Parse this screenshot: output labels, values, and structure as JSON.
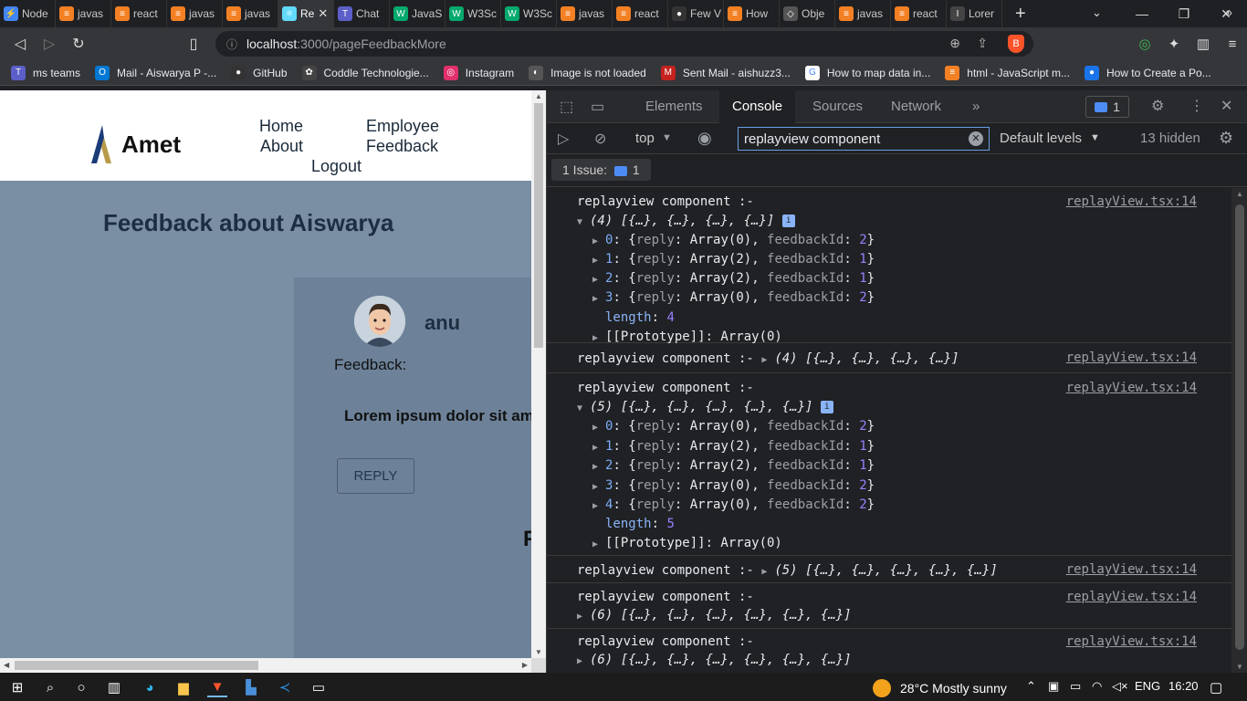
{
  "browser": {
    "tabs": [
      {
        "label": "Node",
        "color": "#4285f4",
        "glyph": "⚡"
      },
      {
        "label": "javas",
        "color": "#f48024",
        "glyph": "≡"
      },
      {
        "label": "react",
        "color": "#f48024",
        "glyph": "≡"
      },
      {
        "label": "javas",
        "color": "#f48024",
        "glyph": "≡"
      },
      {
        "label": "javas",
        "color": "#f48024",
        "glyph": "≡"
      },
      {
        "label": "Re",
        "color": "#61dafb",
        "glyph": "⚛",
        "active": true
      },
      {
        "label": "Chat",
        "color": "#5b5fc7",
        "glyph": "T"
      },
      {
        "label": "JavaS",
        "color": "#04aa6d",
        "glyph": "W"
      },
      {
        "label": "W3Sc",
        "color": "#04aa6d",
        "glyph": "W"
      },
      {
        "label": "W3Sc",
        "color": "#04aa6d",
        "glyph": "W"
      },
      {
        "label": "javas",
        "color": "#f48024",
        "glyph": "≡"
      },
      {
        "label": "react",
        "color": "#f48024",
        "glyph": "≡"
      },
      {
        "label": "Few V",
        "color": "#333333",
        "glyph": "●"
      },
      {
        "label": "How",
        "color": "#f48024",
        "glyph": "≡"
      },
      {
        "label": "Obje",
        "color": "#555555",
        "glyph": "◇"
      },
      {
        "label": "javas",
        "color": "#f48024",
        "glyph": "≡"
      },
      {
        "label": "react",
        "color": "#f48024",
        "glyph": "≡"
      },
      {
        "label": "Lorer",
        "color": "#444444",
        "glyph": "I"
      }
    ],
    "url_host": "localhost",
    "url_path": ":3000/pageFeedbackMore",
    "bookmarks": [
      {
        "label": "ms teams",
        "color": "#5b5fc7",
        "glyph": "T"
      },
      {
        "label": "Mail - Aiswarya P -...",
        "color": "#0078d4",
        "glyph": "O"
      },
      {
        "label": "GitHub",
        "color": "#333333",
        "glyph": "●"
      },
      {
        "label": "Coddle Technologie...",
        "color": "#444444",
        "glyph": "✿"
      },
      {
        "label": "Instagram",
        "color": "#e1306c",
        "glyph": "◎"
      },
      {
        "label": "Image is not loaded",
        "color": "#555555",
        "glyph": "◐"
      },
      {
        "label": "Sent Mail - aishuzz3...",
        "color": "#c5221f",
        "glyph": "M"
      },
      {
        "label": "How to map data in...",
        "color": "#ffffff",
        "glyph": "G"
      },
      {
        "label": "html - JavaScript m...",
        "color": "#f48024",
        "glyph": "≡"
      },
      {
        "label": "How to Create a Po...",
        "color": "#1a73e8",
        "glyph": "●"
      }
    ]
  },
  "app": {
    "logo": "Amet",
    "nav": {
      "home": "Home",
      "employee": "Employee",
      "about": "About",
      "feedback": "Feedback",
      "logout": "Logout"
    },
    "title": "Feedback about Aiswarya",
    "card": {
      "username": "anu",
      "feedback_label": "Feedback:",
      "feedback_text": "Lorem ipsum dolor sit amet",
      "reply": "REPLY",
      "partial_letter": "F"
    }
  },
  "devtools": {
    "tabs": {
      "elements": "Elements",
      "console": "Console",
      "sources": "Sources",
      "network": "Network",
      "more": "»"
    },
    "issue_count": "1",
    "context": "top",
    "filter_value": "replayview component",
    "levels": "Default levels",
    "hidden": "13 hidden",
    "issues_label": "1 Issue:",
    "issues_count": "1"
  },
  "console": {
    "source": "replayView.tsx:14",
    "label": "replayview component :-",
    "entries": {
      "e1_header": "(4) [{…}, {…}, {…}, {…}]",
      "e1_items": [
        {
          "idx": "0",
          "reply": "Array(0)",
          "fid": "2"
        },
        {
          "idx": "1",
          "reply": "Array(2)",
          "fid": "1"
        },
        {
          "idx": "2",
          "reply": "Array(2)",
          "fid": "1"
        },
        {
          "idx": "3",
          "reply": "Array(0)",
          "fid": "2"
        }
      ],
      "e1_length": "4",
      "proto": "[[Prototype]]: Array(0)",
      "e2_collapsed": "(4) [{…}, {…}, {…}, {…}]",
      "e3_header": "(5) [{…}, {…}, {…}, {…}, {…}]",
      "e3_items": [
        {
          "idx": "0",
          "reply": "Array(0)",
          "fid": "2"
        },
        {
          "idx": "1",
          "reply": "Array(2)",
          "fid": "1"
        },
        {
          "idx": "2",
          "reply": "Array(2)",
          "fid": "1"
        },
        {
          "idx": "3",
          "reply": "Array(0)",
          "fid": "2"
        },
        {
          "idx": "4",
          "reply": "Array(0)",
          "fid": "2"
        }
      ],
      "e3_length": "5",
      "e4_collapsed": "(5) [{…}, {…}, {…}, {…}, {…}]",
      "e5_collapsed": "(6) [{…}, {…}, {…}, {…}, {…}, {…}]",
      "e6_collapsed": "(6) [{…}, {…}, {…}, {…}, {…}, {…}]"
    }
  },
  "taskbar": {
    "temperature": "28°C",
    "weather": "Mostly sunny",
    "language": "ENG",
    "time": "16:20"
  }
}
